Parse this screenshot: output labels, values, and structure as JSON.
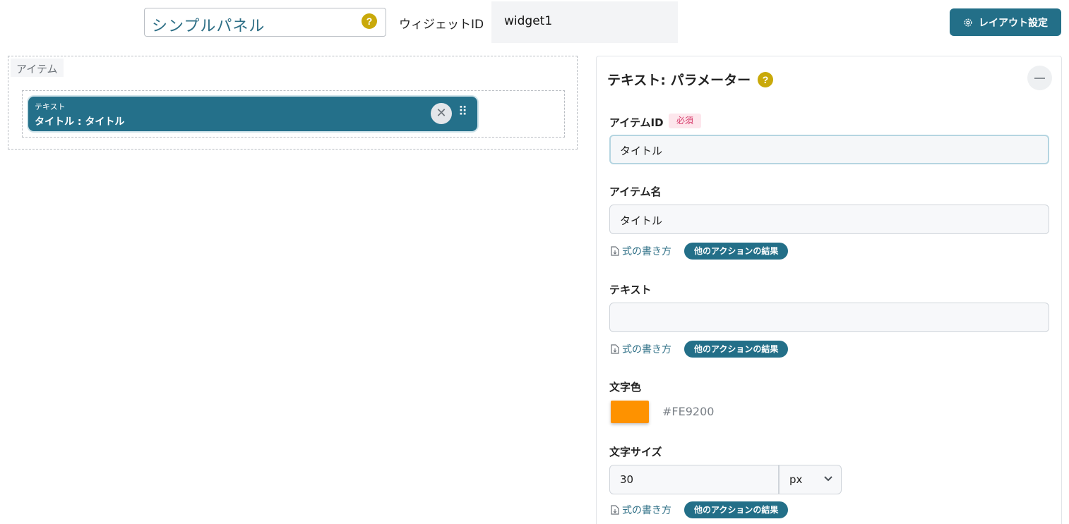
{
  "header": {
    "panel_name": "シンプルパネル",
    "widget_id_label": "ウィジェットID",
    "widget_id_value": "widget1",
    "layout_button": "レイアウト設定"
  },
  "items_area": {
    "label": "アイテム",
    "chip": {
      "type": "テキスト",
      "name": "タイトル : タイトル"
    }
  },
  "panel": {
    "title": "テキスト: パラメーター",
    "item_id": {
      "label": "アイテムID",
      "required": "必須",
      "value": "タイトル"
    },
    "item_name": {
      "label": "アイテム名",
      "value": "タイトル"
    },
    "text": {
      "label": "テキスト",
      "value": ""
    },
    "formula_link": "式の書き方",
    "action_pill": "他のアクションの結果",
    "text_color": {
      "label": "文字色",
      "value": "#FE9200"
    },
    "text_size": {
      "label": "文字サイズ",
      "value": "30",
      "unit": "px"
    }
  },
  "colors": {
    "accent": "#236F88",
    "help": "#C9A90A",
    "swatch": "#FE9200",
    "required": "#D63A6A"
  },
  "icons": [
    "help-icon",
    "gear-icon",
    "close-icon",
    "drag-handle-icon",
    "collapse-icon",
    "document-icon",
    "chevron-down-icon"
  ]
}
